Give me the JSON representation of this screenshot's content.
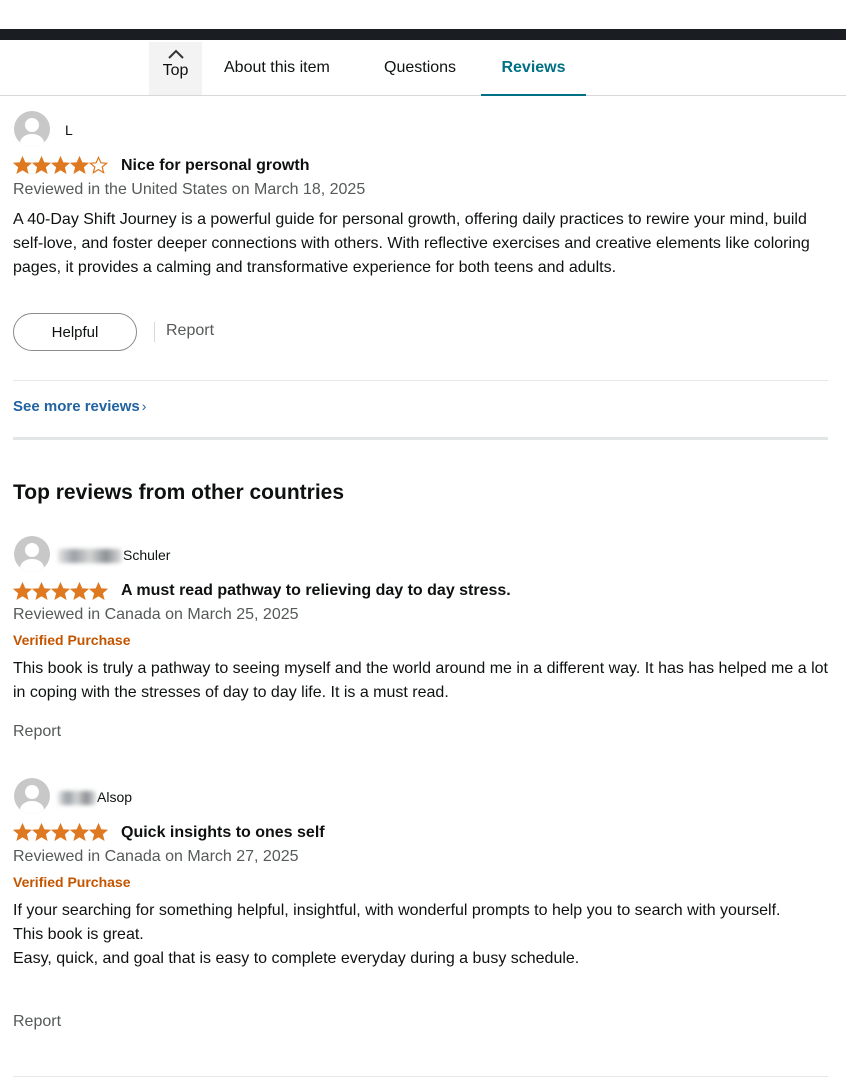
{
  "nav": {
    "top_label": "Top",
    "tabs": [
      {
        "label": "About this item",
        "active": false
      },
      {
        "label": "Questions",
        "active": false
      },
      {
        "label": "Reviews",
        "active": true
      }
    ]
  },
  "first_review": {
    "reviewer": "L",
    "rating": 4,
    "title": "Nice for personal growth",
    "date": "Reviewed in the United States on March 18, 2025",
    "body": "A 40-Day Shift Journey is a powerful guide for personal growth, offering daily practices to rewire your mind, build self-love, and foster deeper connections with others. With reflective exercises and creative elements like coloring pages, it provides a calming and transformative experience for both teens and adults.",
    "helpful_label": "Helpful",
    "report_label": "Report"
  },
  "see_more_label": "See more reviews",
  "other_countries": {
    "section_title": "Top reviews from other countries",
    "reviews": [
      {
        "reviewer": "Schuler",
        "rating": 5,
        "title": "A must read pathway to relieving day to day stress.",
        "date": "Reviewed in Canada on March 25, 2025",
        "verified": "Verified Purchase",
        "body": [
          "This book is truly a pathway to seeing myself and the world around me in a different way. It has has helped me a lot in coping with the stresses of day to day life. It is a must read."
        ],
        "report_label": "Report"
      },
      {
        "reviewer": "Alsop",
        "rating": 5,
        "title": "Quick insights to ones self",
        "date": "Reviewed in Canada on March 27, 2025",
        "verified": "Verified Purchase",
        "body": [
          "If your searching for something helpful, insightful, with wonderful prompts to help you to search with yourself.",
          "This book is great.",
          "Easy, quick, and goal that is easy to complete everyday during a busy schedule."
        ],
        "report_label": "Report"
      }
    ]
  },
  "colors": {
    "star": "#de7921",
    "link": "#2162a1",
    "tab_active": "#007185",
    "verified": "#c45500"
  }
}
